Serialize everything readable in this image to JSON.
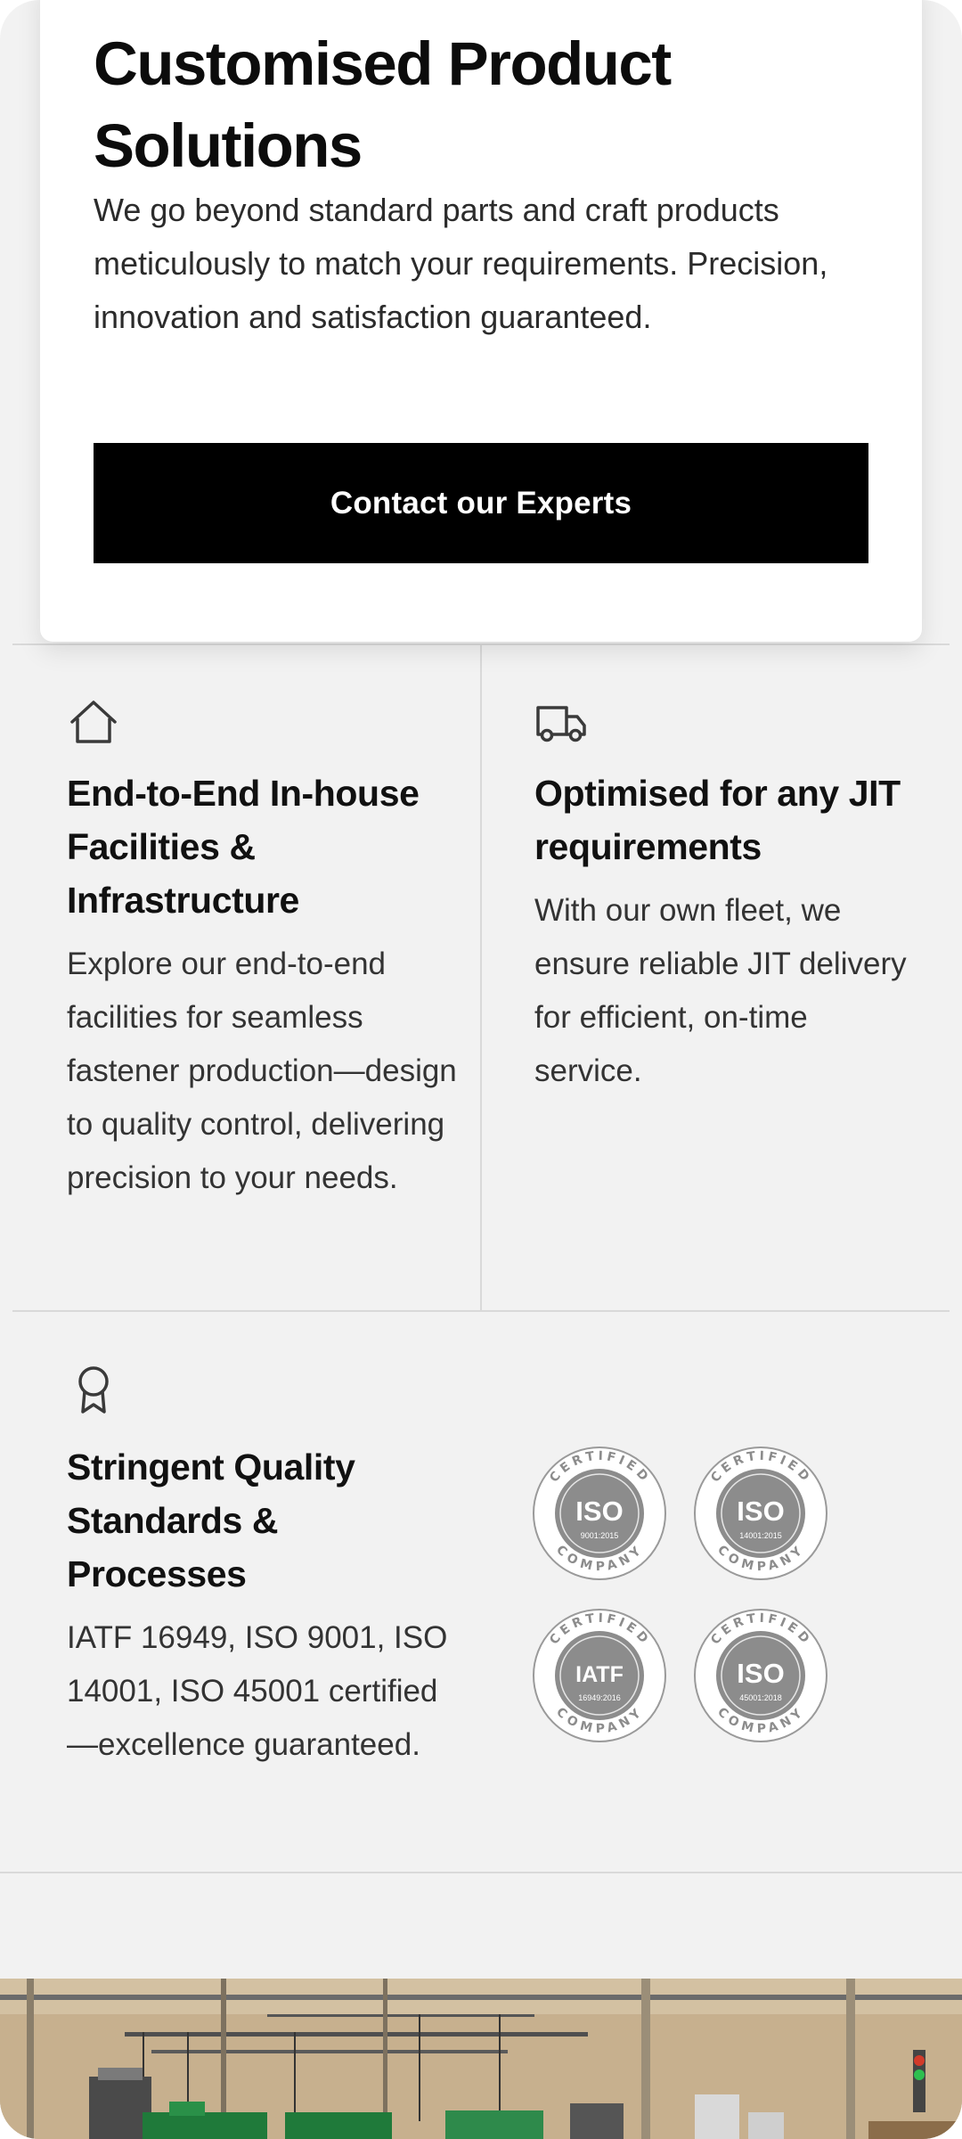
{
  "hero": {
    "title": "Customised Product Solutions",
    "description": "We go beyond standard parts and craft products meticulously to match your requirements. Precision, innovation and satisfaction guaranteed.",
    "cta_label": "Contact our Experts"
  },
  "features": [
    {
      "icon": "house-icon",
      "title": "End-to-End In-house Facilities & Infrastructure",
      "description": "Explore our end-to-end facilities for seamless fastener production—design to quality control, delivering precision to your needs."
    },
    {
      "icon": "truck-icon",
      "title": "Optimised for any JIT requirements",
      "description": "With our own fleet, we ensure reliable JIT delivery for efficient, on-time service."
    },
    {
      "icon": "award-ribbon-icon",
      "title": "Stringent Quality Standards & Processes",
      "description": "IATF 16949, ISO 9001, ISO 14001, ISO 45001 certified—excellence guaranteed."
    }
  ],
  "certifications": [
    {
      "top": "CERTIFIED",
      "mark": "ISO",
      "code": "9001:2015",
      "bottom": "COMPANY"
    },
    {
      "top": "CERTIFIED",
      "mark": "ISO",
      "code": "14001:2015",
      "bottom": "COMPANY"
    },
    {
      "top": "CERTIFIED",
      "mark": "IATF",
      "code": "16949:2016",
      "bottom": "COMPANY"
    },
    {
      "top": "CERTIFIED",
      "mark": "ISO",
      "code": "45001:2018",
      "bottom": "COMPANY"
    }
  ],
  "colors": {
    "page_bg": "#f2f2f2",
    "card_bg": "#ffffff",
    "button_bg": "#000000",
    "button_text": "#ffffff",
    "badge_gray": "#8c8c8c"
  }
}
